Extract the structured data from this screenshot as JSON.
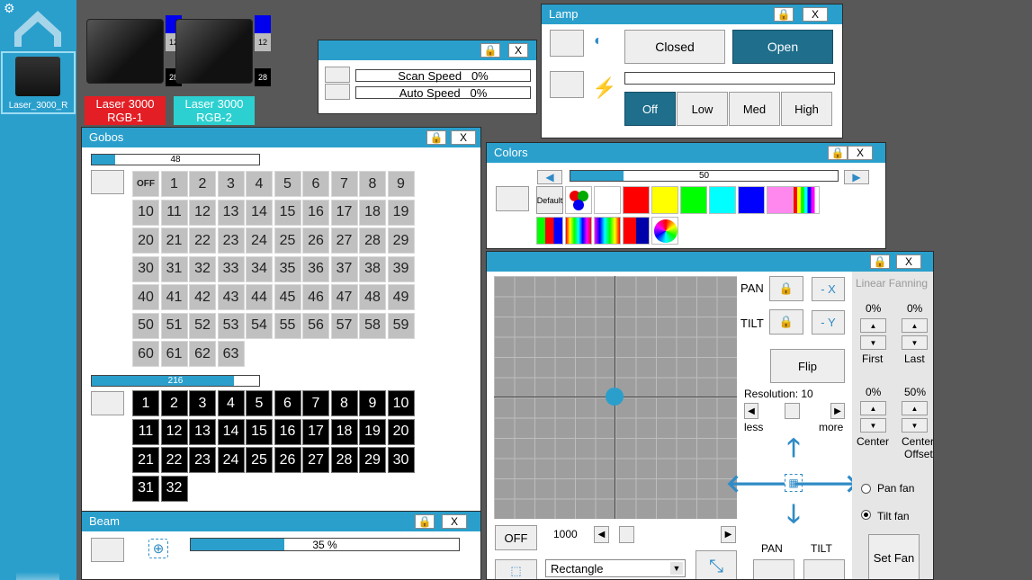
{
  "sidebar": {
    "fixture_label": "Laser_3000_R"
  },
  "fixtures": [
    {
      "badge_top": "12",
      "badge_bottom": "28",
      "label_line1": "Laser 3000",
      "label_line2": "RGB-1",
      "color": "#e31e25"
    },
    {
      "badge_top": "12",
      "badge_bottom": "28",
      "label_line1": "Laser 3000",
      "label_line2": "RGB-2",
      "color": "#2dd0d0"
    }
  ],
  "speed": {
    "close": "X",
    "scan_label": "Scan Speed",
    "scan_value": "0%",
    "auto_label": "Auto Speed",
    "auto_value": "0%"
  },
  "lamp": {
    "title": "Lamp",
    "close": "X",
    "closed": "Closed",
    "open": "Open",
    "off": "Off",
    "low": "Low",
    "med": "Med",
    "high": "High"
  },
  "gobos": {
    "title": "Gobos",
    "close": "X",
    "bar1_value": "48",
    "bar1_fraction": 0.14,
    "off": "OFF",
    "grid1": [
      "1",
      "2",
      "3",
      "4",
      "5",
      "6",
      "7",
      "8",
      "9",
      "10",
      "11",
      "12",
      "13",
      "14",
      "15",
      "16",
      "17",
      "18",
      "19",
      "20",
      "21",
      "22",
      "23",
      "24",
      "25",
      "26",
      "27",
      "28",
      "29",
      "30",
      "31",
      "32",
      "33",
      "34",
      "35",
      "36",
      "37",
      "38",
      "39",
      "40",
      "41",
      "42",
      "43",
      "44",
      "45",
      "46",
      "47",
      "48",
      "49",
      "50",
      "51",
      "52",
      "53",
      "54",
      "55",
      "56",
      "57",
      "58",
      "59",
      "60",
      "61",
      "62",
      "63"
    ],
    "bar2_value": "216",
    "bar2_fraction": 0.85,
    "grid2": [
      "1",
      "2",
      "3",
      "4",
      "5",
      "6",
      "7",
      "8",
      "9",
      "10",
      "11",
      "12",
      "13",
      "14",
      "15",
      "16",
      "17",
      "18",
      "19",
      "20",
      "21",
      "22",
      "23",
      "24",
      "25",
      "26",
      "27",
      "28",
      "29",
      "30",
      "31",
      "32"
    ]
  },
  "colors": {
    "title": "Colors",
    "close": "X",
    "bar_value": "50",
    "bar_fraction": 0.2,
    "default": "Default",
    "swatches": [
      "#ffffff",
      "#ff0000",
      "#ffff00",
      "#00ff00",
      "#00ffff",
      "#0000ff",
      "#ff88ee"
    ]
  },
  "beam": {
    "title": "Beam",
    "close": "X",
    "value": "35 %",
    "fraction": 0.35
  },
  "pantilt": {
    "close": "X",
    "pan": "PAN",
    "tilt": "TILT",
    "minus_x": "- X",
    "minus_y": "- Y",
    "flip": "Flip",
    "resolution": "Resolution: 10",
    "less": "less",
    "more": "more",
    "linear_fanning": "Linear Fanning",
    "first_value": "0%",
    "last_value": "0%",
    "first": "First",
    "last": "Last",
    "center_value": "0%",
    "center_offset_value": "50%",
    "center": "Center",
    "center_offset_1": "Center",
    "center_offset_2": "Offset",
    "pan_fan": "Pan fan",
    "tilt_fan": "Tilt fan",
    "set_fan": "Set Fan",
    "off": "OFF",
    "speed_value": "1000",
    "shape": "Rectangle",
    "bottom_pan": "PAN",
    "bottom_tilt": "TILT"
  }
}
